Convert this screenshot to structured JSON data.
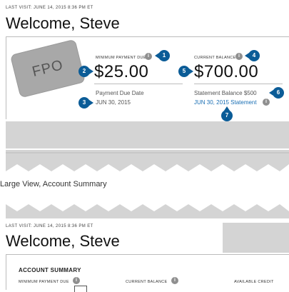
{
  "top": {
    "last_visit": "LAST VISIT: JUNE 14, 2015 8:36 PM ET",
    "welcome": "Welcome, Steve",
    "card_placeholder": "FPO",
    "min_payment_label": "MINIMUM PAYMENT DUE",
    "min_payment_amount": "$25.00",
    "payment_due_label": "Payment Due Date",
    "payment_due_date": "JUN 30, 2015",
    "current_balance_label": "CURRENT BALANCE",
    "current_balance_amount": "$700.00",
    "statement_balance_text": "Statement Balance $500",
    "statement_link": "JUN 30, 2015 Statement",
    "info_glyph": "i",
    "markers": [
      "1",
      "2",
      "3",
      "4",
      "5",
      "6",
      "7"
    ]
  },
  "caption": "Large View, Account Summary",
  "bottom": {
    "last_visit": "LAST VISIT: JUNE 14, 2015 8:36 PM ET",
    "welcome": "Welcome, Steve",
    "section_title": "ACCOUNT SUMMARY",
    "min_payment_label": "MINIMUM PAYMENT DUE",
    "current_balance_label": "CURRENT BALANCE",
    "available_credit_label": "AVAILABLE CREDIT",
    "info_glyph": "i"
  },
  "colors": {
    "marker": "#0b5c97",
    "link": "#1a6fb4",
    "grey_panel": "#d4d4d4",
    "card": "#a8a8a8"
  }
}
